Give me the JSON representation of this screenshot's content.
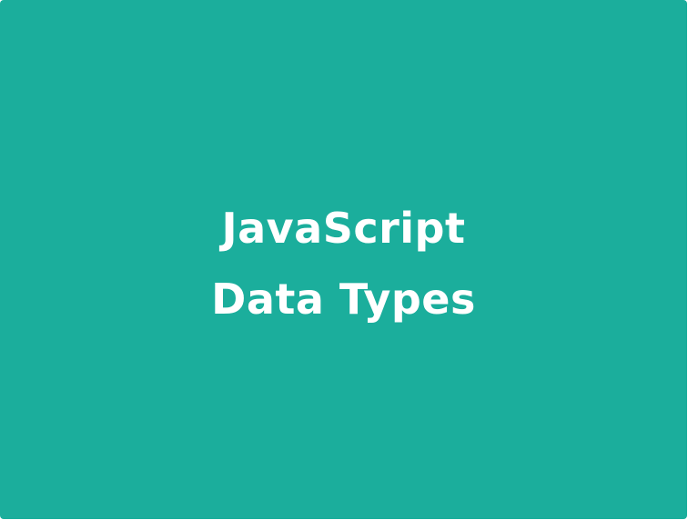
{
  "card": {
    "background_color": "#1bae9c",
    "title_lines": [
      "JavaScript",
      "Data Types"
    ],
    "text_color": "#ffffff"
  }
}
